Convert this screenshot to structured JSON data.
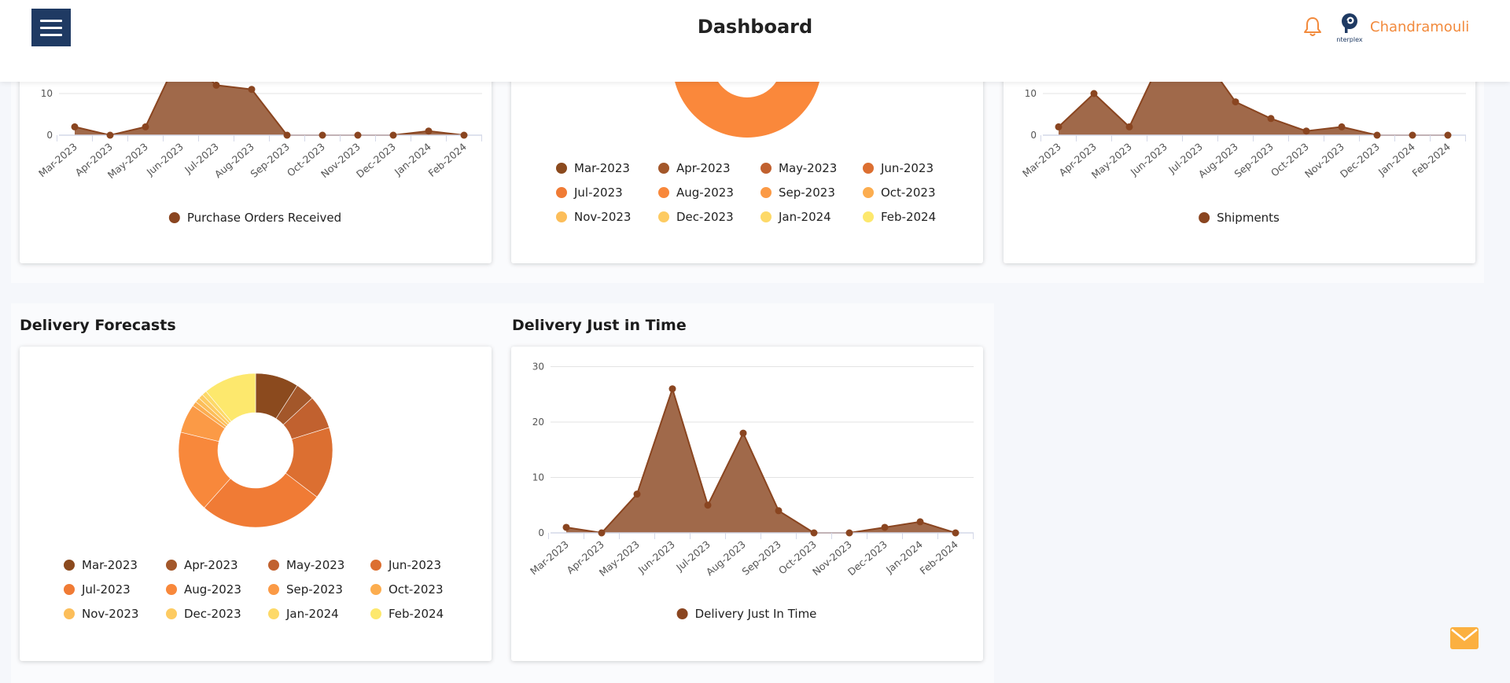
{
  "header": {
    "title": "Dashboard",
    "user_name": "Chandramouli",
    "logo_text": "nterplex"
  },
  "colors": {
    "accent": "#f28a3c",
    "header_nav": "#1f3a63",
    "area_fill": "#a0694a",
    "area_line": "#8a4520"
  },
  "months": [
    "Mar-2023",
    "Apr-2023",
    "May-2023",
    "Jun-2023",
    "Jul-2023",
    "Aug-2023",
    "Sep-2023",
    "Oct-2023",
    "Nov-2023",
    "Dec-2023",
    "Jan-2024",
    "Feb-2024"
  ],
  "donut_colors": [
    "#8b4a1e",
    "#a3572a",
    "#c1612f",
    "#dc6f31",
    "#f07b35",
    "#f8883b",
    "#fb9a46",
    "#fcad4f",
    "#fcbe5a",
    "#fdcb62",
    "#fdd968",
    "#fde86d"
  ],
  "sections": {
    "delivery_forecasts": "Delivery Forecasts",
    "delivery_just_in_time": "Delivery Just in Time"
  },
  "chart_data": [
    {
      "type": "area",
      "legend": "Purchase Orders Received",
      "x": [
        "Mar-2023",
        "Apr-2023",
        "May-2023",
        "Jun-2023",
        "Jul-2023",
        "Aug-2023",
        "Sep-2023",
        "Oct-2023",
        "Nov-2023",
        "Dec-2023",
        "Jan-2024",
        "Feb-2024"
      ],
      "values": [
        2,
        0,
        2,
        20,
        12,
        11,
        0,
        0,
        0,
        0,
        1,
        0
      ],
      "yticks": [
        0,
        10
      ],
      "grid": true,
      "legend_position": "bottom"
    },
    {
      "type": "pie",
      "legend": [
        "Mar-2023",
        "Apr-2023",
        "May-2023",
        "Jun-2023",
        "Jul-2023",
        "Aug-2023",
        "Sep-2023",
        "Oct-2023",
        "Nov-2023",
        "Dec-2023",
        "Jan-2024",
        "Feb-2024"
      ],
      "legend_position": "bottom"
    },
    {
      "type": "area",
      "legend": "Shipments",
      "x": [
        "Mar-2023",
        "Apr-2023",
        "May-2023",
        "Jun-2023",
        "Jul-2023",
        "Aug-2023",
        "Sep-2023",
        "Oct-2023",
        "Nov-2023",
        "Dec-2023",
        "Jan-2024",
        "Feb-2024"
      ],
      "values": [
        2,
        10,
        2,
        20,
        20,
        8,
        4,
        1,
        2,
        0,
        0,
        0
      ],
      "yticks": [
        0,
        10
      ],
      "grid": true,
      "legend_position": "bottom"
    },
    {
      "type": "pie",
      "title": "Delivery Forecasts",
      "labels": [
        "Mar-2023",
        "Apr-2023",
        "May-2023",
        "Jun-2023",
        "Jul-2023",
        "Aug-2023",
        "Sep-2023",
        "Oct-2023",
        "Nov-2023",
        "Dec-2023",
        "Jan-2024",
        "Feb-2024"
      ],
      "values": [
        9,
        4,
        7,
        15,
        26,
        17,
        6,
        1,
        1,
        1,
        1,
        11
      ],
      "donut": true,
      "legend_position": "bottom"
    },
    {
      "type": "area",
      "title": "Delivery Just in Time",
      "legend": "Delivery Just In Time",
      "x": [
        "Mar-2023",
        "Apr-2023",
        "May-2023",
        "Jun-2023",
        "Jul-2023",
        "Aug-2023",
        "Sep-2023",
        "Oct-2023",
        "Nov-2023",
        "Dec-2023",
        "Jan-2024",
        "Feb-2024"
      ],
      "values": [
        1,
        0,
        7,
        26,
        5,
        18,
        4,
        0,
        0,
        1,
        2,
        0
      ],
      "ylim": [
        0,
        30
      ],
      "yticks": [
        0,
        10,
        20,
        30
      ],
      "grid": true,
      "legend_position": "bottom"
    }
  ]
}
